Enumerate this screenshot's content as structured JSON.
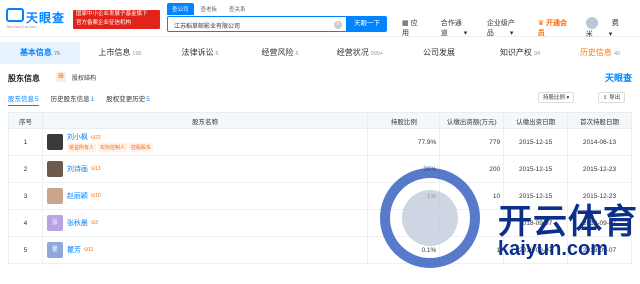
{
  "logo": {
    "text": "天眼查",
    "url": "TianYanCha.com"
  },
  "badge": {
    "line1": "国家中小企业发展子基金旗下",
    "line2": "官方备案企业征信机构"
  },
  "search_tabs": [
    "查公司",
    "查老板",
    "查关系"
  ],
  "search": {
    "value": "江苏稻草邮影业有限公司",
    "button": "天眼一下"
  },
  "nav": {
    "app": "应用",
    "partner": "合作通道",
    "service": "企业级产品",
    "vip": "开通会员",
    "user": "费米"
  },
  "tabs": [
    {
      "label": "基本信息",
      "count": "76"
    },
    {
      "label": "上市信息",
      "count": "195"
    },
    {
      "label": "法律诉讼",
      "count": "6"
    },
    {
      "label": "经营风险",
      "count": "6"
    },
    {
      "label": "经营状况",
      "count": "999+"
    },
    {
      "label": "公司发展",
      "count": ""
    },
    {
      "label": "知识产权",
      "count": "94"
    },
    {
      "label": "历史信息",
      "count": "40"
    }
  ],
  "panel": {
    "title": "股东信息",
    "link": "股权结构",
    "logo": "天眼查"
  },
  "subtabs": [
    {
      "label": "股东信息",
      "n": "5"
    },
    {
      "label": "历史股东信息",
      "n": "1"
    },
    {
      "label": "股权变更历史",
      "n": "5"
    }
  ],
  "controls": {
    "sort": "持股比例",
    "export": "导出"
  },
  "headers": [
    "序号",
    "股东名称",
    "持股比例",
    "认缴出资额(万元)",
    "认缴出资日期",
    "首次持股日期"
  ],
  "rows": [
    {
      "no": "1",
      "name": "刘小枫",
      "tag": "22",
      "tags": [
        "受益所有人",
        "实际控制人",
        "控股股东"
      ],
      "ratio": "77.9%",
      "amount": "779",
      "date": "2015-12-15",
      "first": "2014-06-13",
      "color": "#3a3a3a"
    },
    {
      "no": "2",
      "name": "刘诗画",
      "tag": "13",
      "tags": [],
      "ratio": "20%",
      "amount": "200",
      "date": "2015-12-15",
      "first": "2015-12-23",
      "color": "#6b5a4e"
    },
    {
      "no": "3",
      "name": "赵丽颖",
      "tag": "10",
      "tags": [],
      "ratio": "1%",
      "amount": "10",
      "date": "2015-12-15",
      "first": "2015-12-23",
      "color": "#c9a58c"
    },
    {
      "no": "4",
      "name": "张秋晨",
      "tag": "3",
      "tags": [],
      "ratio": "",
      "amount": "",
      "date": "2018-09-07",
      "first": "2018-09-07",
      "color": "#b9a3e0",
      "initial": "张"
    },
    {
      "no": "5",
      "name": "瞿芳",
      "tag": "11",
      "tags": [],
      "ratio": "0.1%",
      "amount": "1",
      "date": "2018-09-07",
      "first": "2018-09-07",
      "color": "#8fa7d9",
      "initial": "瞿"
    }
  ],
  "watermark": {
    "cn": "开云体育",
    "en": "kaiyun.com"
  }
}
